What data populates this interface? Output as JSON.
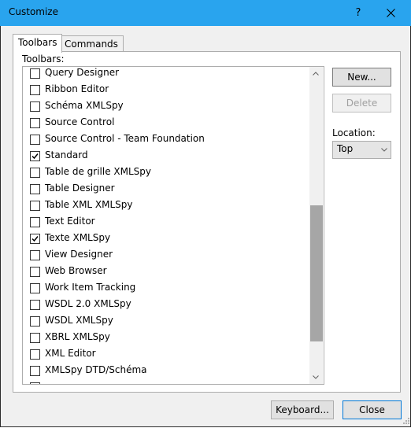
{
  "window": {
    "title": "Customize",
    "help_label": "?",
    "titlebar_color": "#29a4ee"
  },
  "tabs": [
    {
      "label": "Toolbars",
      "active": true
    },
    {
      "label": "Commands",
      "active": false
    }
  ],
  "toolbars_panel": {
    "list_label": "Toolbars:",
    "items": [
      {
        "label": "Query Designer",
        "checked": false
      },
      {
        "label": "Ribbon Editor",
        "checked": false
      },
      {
        "label": "Schéma XMLSpy",
        "checked": false
      },
      {
        "label": "Source Control",
        "checked": false
      },
      {
        "label": "Source Control - Team Foundation",
        "checked": false
      },
      {
        "label": "Standard",
        "checked": true
      },
      {
        "label": "Table de grille XMLSpy",
        "checked": false
      },
      {
        "label": "Table Designer",
        "checked": false
      },
      {
        "label": "Table XML XMLSpy",
        "checked": false
      },
      {
        "label": "Text Editor",
        "checked": false
      },
      {
        "label": "Texte XMLSpy",
        "checked": true
      },
      {
        "label": "View Designer",
        "checked": false
      },
      {
        "label": "Web Browser",
        "checked": false
      },
      {
        "label": "Work Item Tracking",
        "checked": false
      },
      {
        "label": "WSDL 2.0 XMLSpy",
        "checked": false
      },
      {
        "label": "WSDL XMLSpy",
        "checked": false
      },
      {
        "label": "XBRL XMLSpy",
        "checked": false
      },
      {
        "label": "XML Editor",
        "checked": false
      },
      {
        "label": "XMLSpy DTD/Schéma",
        "checked": false
      },
      {
        "label": "",
        "checked": false
      }
    ],
    "scroll_position": {
      "thumb_start_fraction": 0.43,
      "thumb_end_fraction": 0.9
    },
    "new_button": "New...",
    "delete_button": "Delete",
    "location_label": "Location:",
    "location_value": "Top"
  },
  "footer": {
    "keyboard_button": "Keyboard...",
    "close_button": "Close"
  }
}
